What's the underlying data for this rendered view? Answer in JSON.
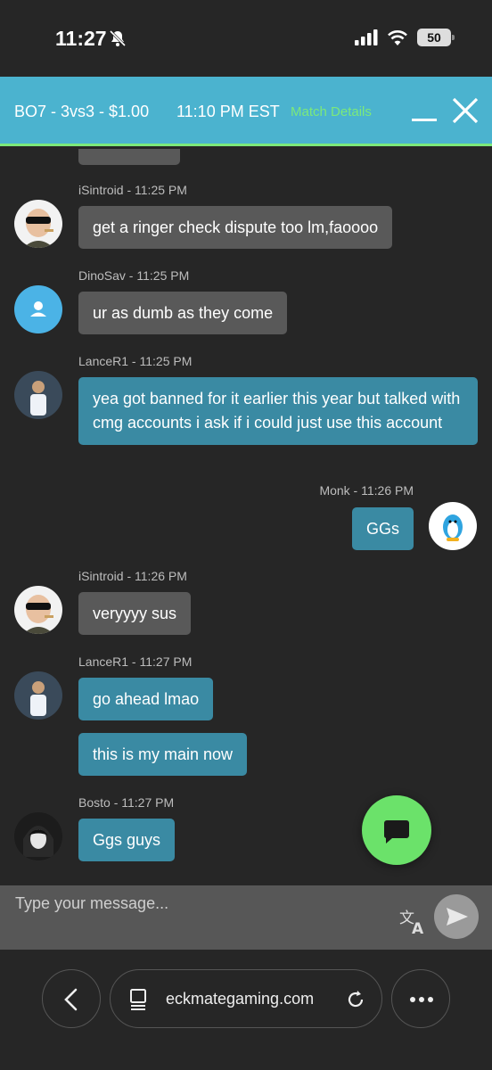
{
  "status_bar": {
    "time": "11:27",
    "battery": "50"
  },
  "header": {
    "title": "BO7 - 3vs3 - $1.00",
    "match_time": "11:10 PM EST",
    "details_link": "Match Details"
  },
  "messages": [
    {
      "meta": "iSintroid - 11:25 PM",
      "text": "get a ringer check dispute too lm,faoooo"
    },
    {
      "meta": "DinoSav - 11:25 PM",
      "text": "ur as dumb as they come"
    },
    {
      "meta": "LanceR1 - 11:25 PM",
      "text": "yea got banned for it earlier this year but talked with cmg accounts i ask if i could just use this account"
    },
    {
      "meta": "Monk - 11:26 PM",
      "text": "GGs"
    },
    {
      "meta": "iSintroid - 11:26 PM",
      "text": "veryyyy sus"
    },
    {
      "meta": "LanceR1 - 11:27 PM",
      "text": "go ahead lmao"
    },
    {
      "meta": "",
      "text": "this is my main now"
    },
    {
      "meta": "Bosto - 11:27 PM",
      "text": "Ggs guys"
    }
  ],
  "input": {
    "placeholder": "Type your message..."
  },
  "browser": {
    "url": "eckmategaming.com"
  },
  "icons": [
    "bell-off-icon",
    "signal-icon",
    "wifi-icon",
    "battery-icon",
    "minimize-icon",
    "close-icon",
    "chat-icon",
    "translate-icon",
    "send-icon",
    "back-icon",
    "tabs-icon",
    "reload-icon",
    "more-icon"
  ],
  "colors": {
    "header": "#4bb3cf",
    "accent_green": "#7ce97a",
    "bubble_self": "#3a8aa3",
    "bubble_other": "#595959"
  }
}
